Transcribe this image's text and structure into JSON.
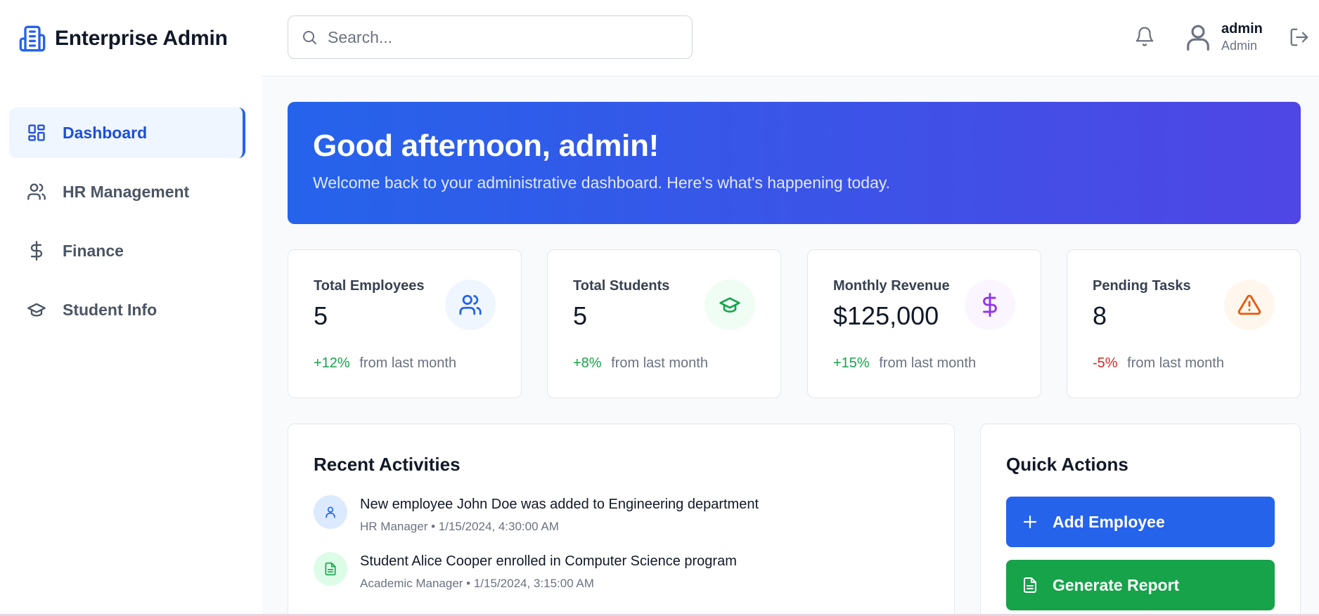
{
  "app": {
    "brand_name": "Enterprise Admin",
    "brand_icon": "building-icon",
    "accent_color": "#2563eb"
  },
  "sidebar": {
    "items": [
      {
        "label": "Dashboard",
        "icon": "grid-icon",
        "active": true
      },
      {
        "label": "HR Management",
        "icon": "users-icon",
        "active": false
      },
      {
        "label": "Finance",
        "icon": "dollar-icon",
        "active": false
      },
      {
        "label": "Student Info",
        "icon": "graduation-cap-icon",
        "active": false
      }
    ]
  },
  "header": {
    "search_placeholder": "Search...",
    "search_value": "",
    "user_name": "admin",
    "user_role": "Admin"
  },
  "hero": {
    "greeting": "Good afternoon, admin!",
    "subtitle": "Welcome back to your administrative dashboard. Here's what's happening today."
  },
  "stats": [
    {
      "label": "Total Employees",
      "value": "5",
      "change": "+12%",
      "change_suffix": "from last month",
      "icon": "users-icon",
      "color": "#2563eb"
    },
    {
      "label": "Total Students",
      "value": "5",
      "change": "+8%",
      "change_suffix": "from last month",
      "icon": "graduation-cap-icon",
      "color": "#16a34a"
    },
    {
      "label": "Monthly Revenue",
      "value": "$125,000",
      "change": "+15%",
      "change_suffix": "from last month",
      "icon": "dollar-icon",
      "color": "#9333ea"
    },
    {
      "label": "Pending Tasks",
      "value": "8",
      "change": "-5%",
      "change_suffix": "from last month",
      "icon": "alert-triangle-icon",
      "color": "#ea580c"
    }
  ],
  "activities": {
    "title": "Recent Activities",
    "items": [
      {
        "text": "New employee John Doe was added to Engineering department",
        "meta": "HR Manager • 1/15/2024, 4:30:00 AM",
        "icon": "user-icon"
      },
      {
        "text": "Student Alice Cooper enrolled in Computer Science program",
        "meta": "Academic Manager • 1/15/2024, 3:15:00 AM",
        "icon": "document-icon"
      }
    ]
  },
  "quick_actions": {
    "title": "Quick Actions",
    "buttons": [
      {
        "label": "Add Employee",
        "icon": "plus-icon",
        "color": "#2563eb"
      },
      {
        "label": "Generate Report",
        "icon": "document-icon",
        "color": "#16a34a"
      }
    ]
  }
}
